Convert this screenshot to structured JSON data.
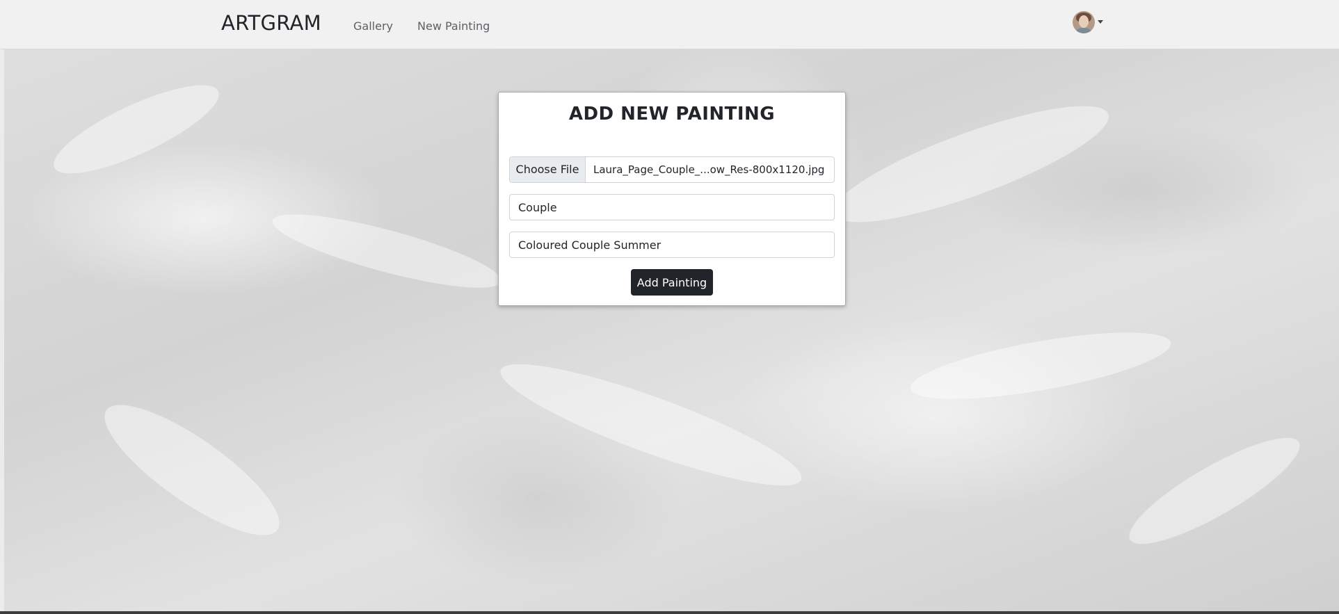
{
  "navbar": {
    "brand": "ARTGRAM",
    "links": [
      {
        "label": "Gallery"
      },
      {
        "label": "New Painting"
      }
    ]
  },
  "form": {
    "title": "ADD NEW PAINTING",
    "file_button_label": "Choose File",
    "file_name": "Laura_Page_Couple_...ow_Res-800x1120.jpg",
    "title_field_value": "Couple",
    "tags_field_value": "Coloured Couple Summer",
    "submit_label": "Add Painting"
  },
  "colors": {
    "navbar_bg": "#f1f1f1",
    "brand_text": "#212529",
    "button_dark": "#212529",
    "background_texture": "#d8d8d8"
  },
  "icons": {
    "profile": "avatar",
    "dropdown": "caret-down-icon"
  }
}
